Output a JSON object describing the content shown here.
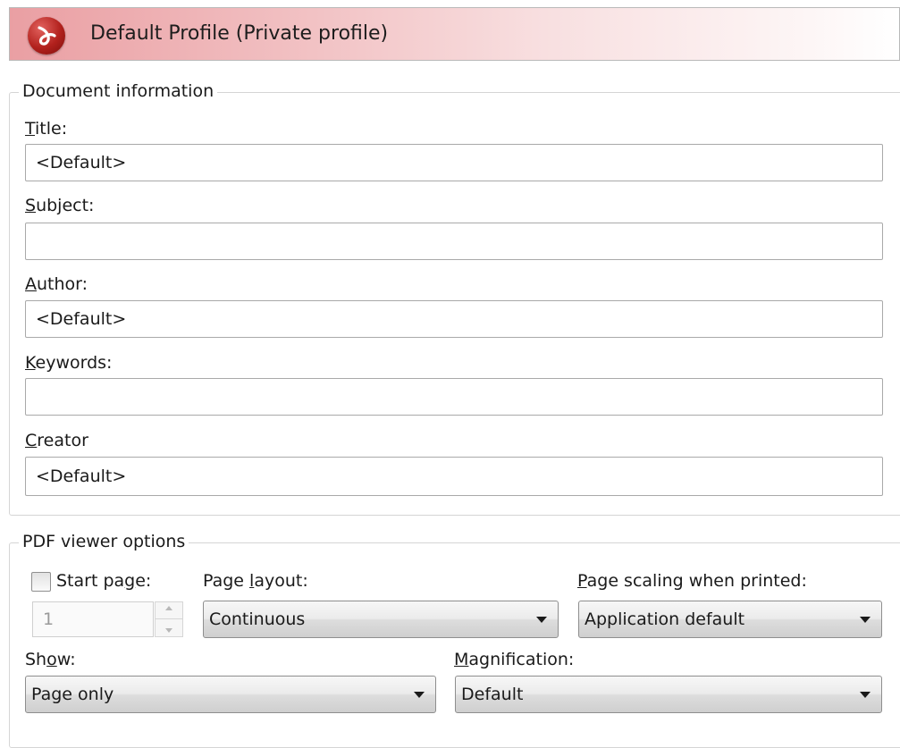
{
  "header": {
    "title": "Default Profile (Private profile)",
    "logo_icon": "novapdf-logo-icon"
  },
  "document_information": {
    "legend": "Document information",
    "title_label": {
      "pre": "",
      "key": "T",
      "post": "itle:"
    },
    "title_value": "<Default>",
    "subject_label": {
      "pre": "",
      "key": "S",
      "post": "ubject:"
    },
    "subject_value": "",
    "author_label": {
      "pre": "",
      "key": "A",
      "post": "uthor:"
    },
    "author_value": "<Default>",
    "keywords_label": {
      "pre": "",
      "key": "K",
      "post": "eywords:"
    },
    "keywords_value": "",
    "creator_label": {
      "pre": "",
      "key": "C",
      "post": "reator"
    },
    "creator_value": "<Default>"
  },
  "pdf_viewer_options": {
    "legend": "PDF viewer options",
    "start_page_label": {
      "pre": "Start pa",
      "key": "g",
      "post": "e:"
    },
    "start_page_checked": false,
    "start_page_value": "1",
    "page_layout_label": {
      "pre": "Page ",
      "key": "l",
      "post": "ayout:"
    },
    "page_layout_value": "Continuous",
    "page_scaling_label": {
      "pre": "",
      "key": "P",
      "post": "age scaling when printed:"
    },
    "page_scaling_value": "Application default",
    "show_label": {
      "pre": "Sh",
      "key": "o",
      "post": "w:"
    },
    "show_value": "Page only",
    "magnification_label": {
      "pre": "",
      "key": "M",
      "post": "agnification:"
    },
    "magnification_value": "Default"
  },
  "colors": {
    "header_gradient_start": "#ea9fa3",
    "logo_red": "#b2211d"
  }
}
